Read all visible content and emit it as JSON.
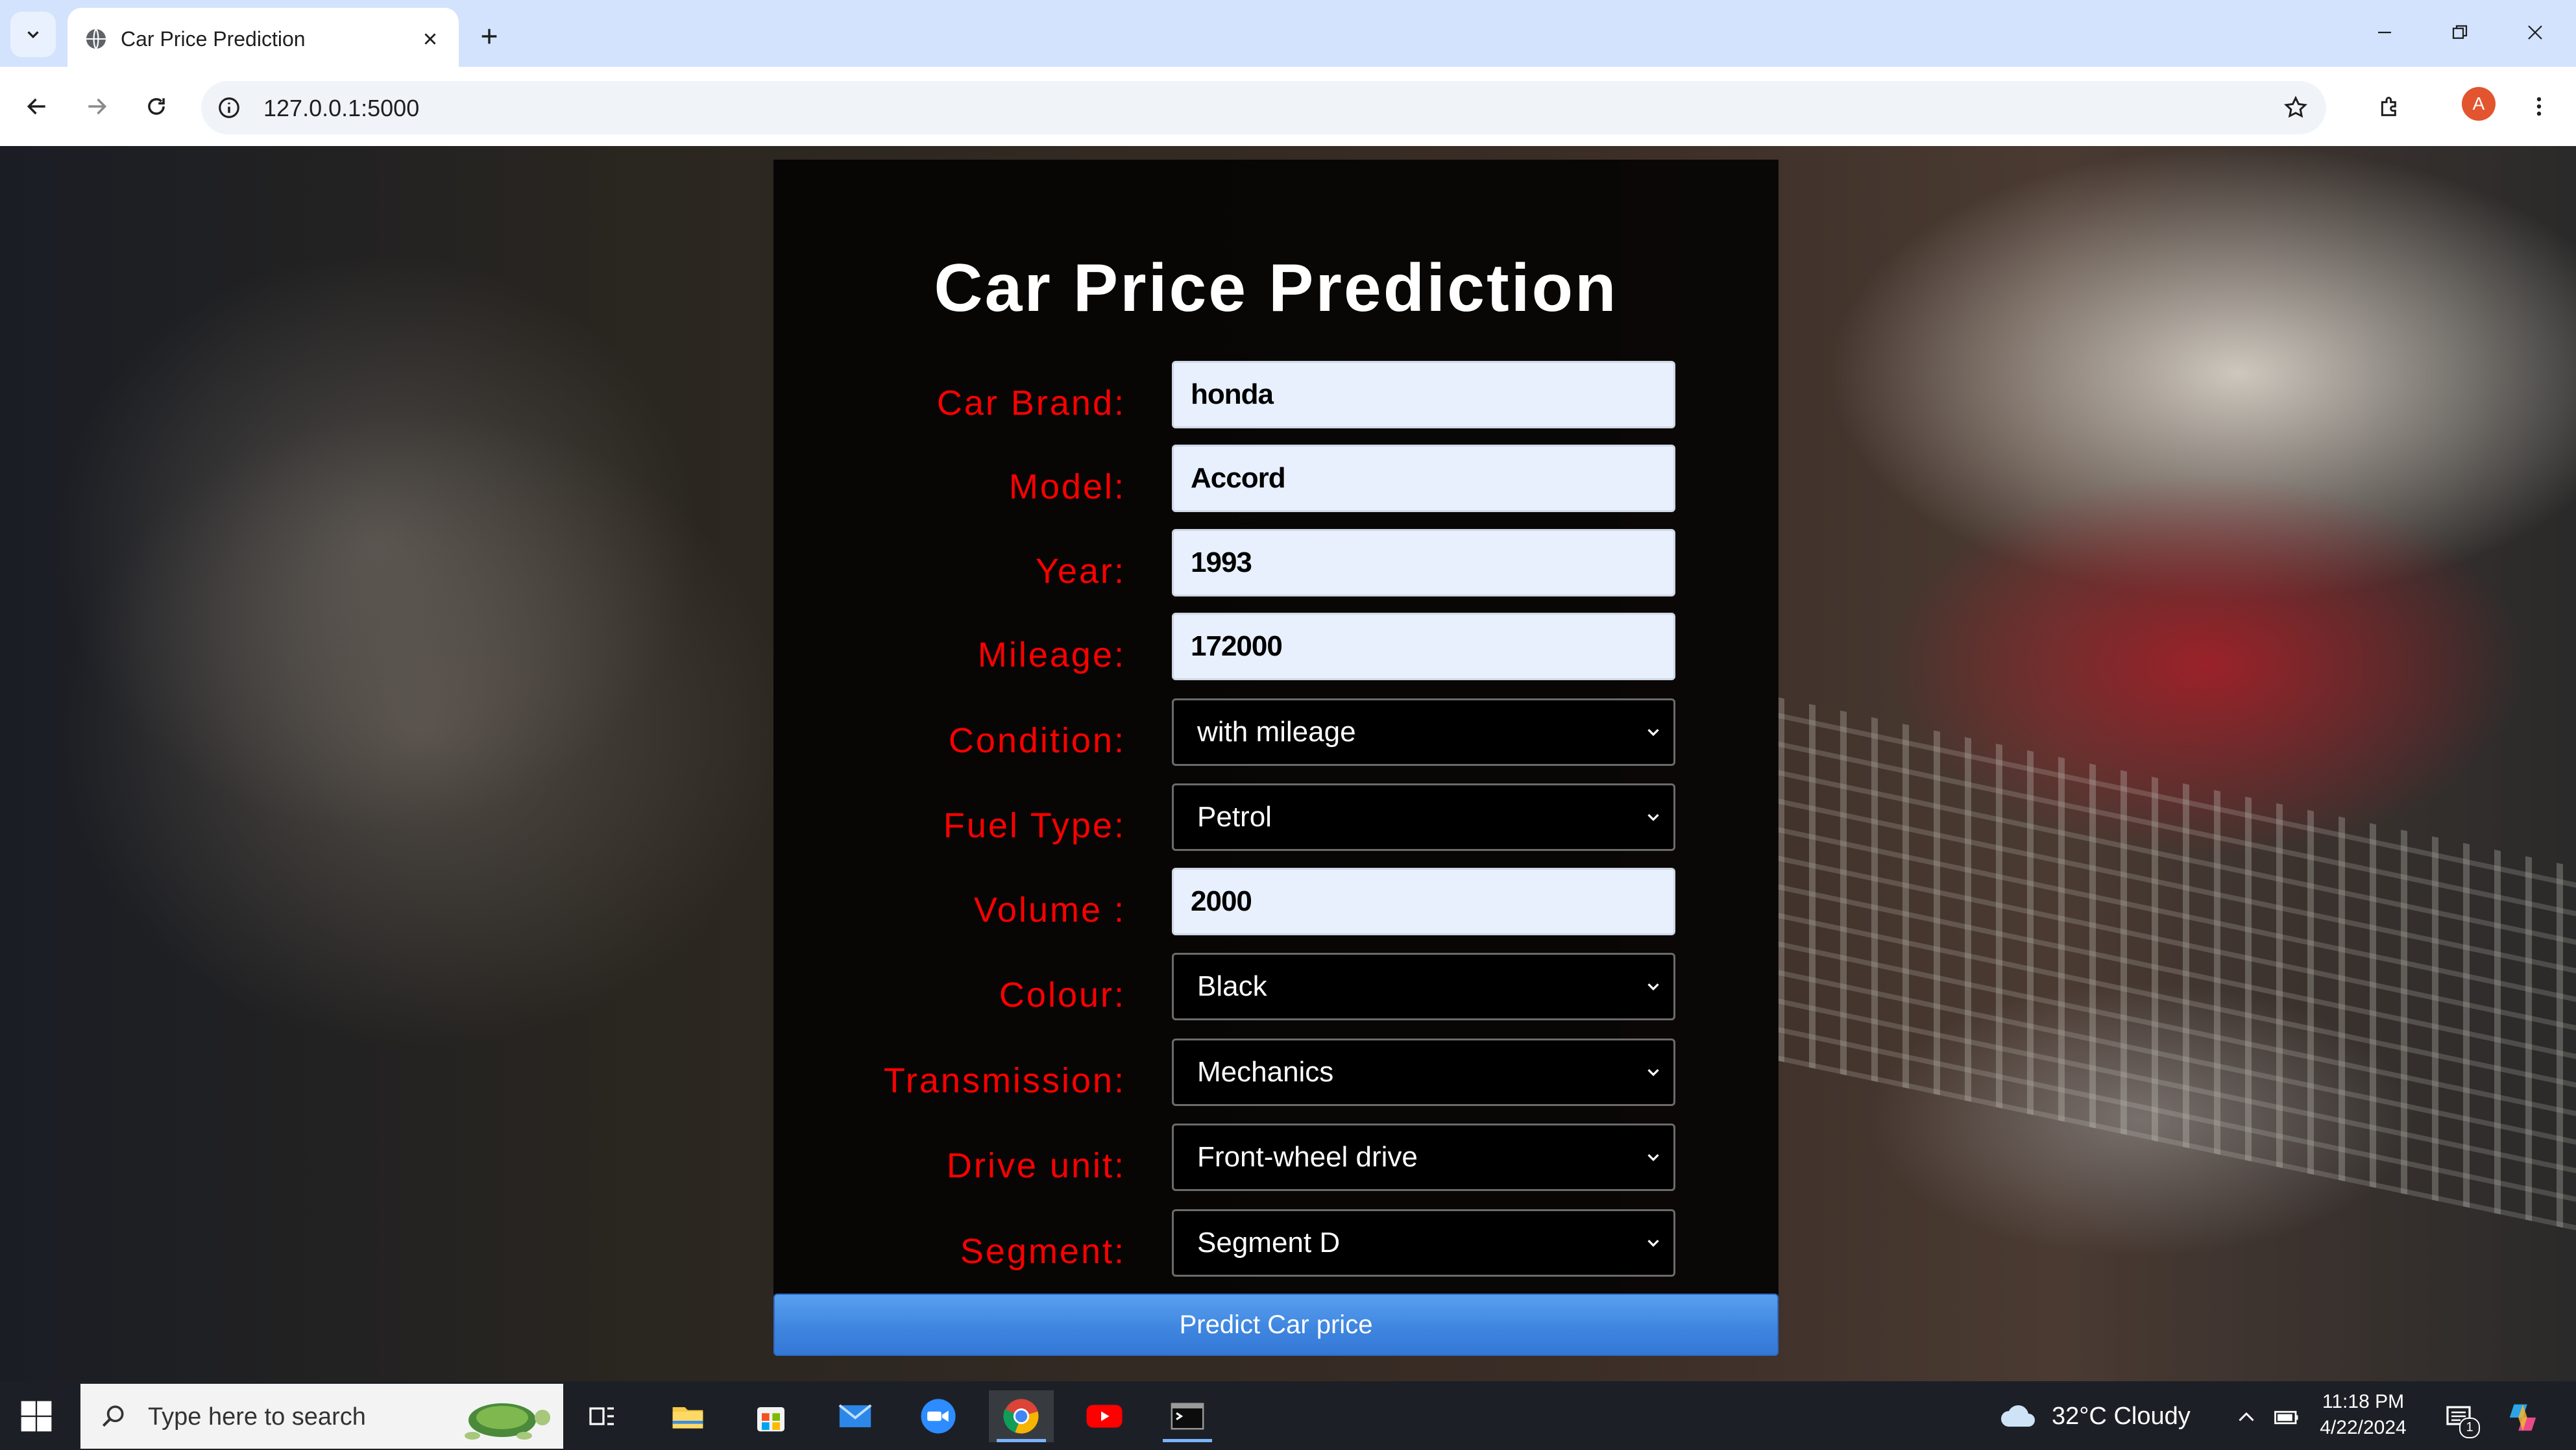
{
  "browser": {
    "tab_title": "Car Price Prediction",
    "url": "127.0.0.1:5000",
    "profile_initial": "A"
  },
  "form": {
    "title": "Car Price Prediction",
    "fields": [
      {
        "label": "Car Brand:",
        "type": "text",
        "value": "honda"
      },
      {
        "label": "Model:",
        "type": "text",
        "value": "Accord"
      },
      {
        "label": "Year:",
        "type": "text",
        "value": "1993"
      },
      {
        "label": "Mileage:",
        "type": "text",
        "value": "172000"
      },
      {
        "label": "Condition:",
        "type": "select",
        "value": "with mileage"
      },
      {
        "label": "Fuel Type:",
        "type": "select",
        "value": "Petrol"
      },
      {
        "label": "Volume :",
        "type": "text",
        "value": "2000"
      },
      {
        "label": "Colour:",
        "type": "select",
        "value": "Black"
      },
      {
        "label": "Transmission:",
        "type": "select",
        "value": "Mechanics"
      },
      {
        "label": "Drive unit:",
        "type": "select",
        "value": "Front-wheel drive"
      },
      {
        "label": "Segment:",
        "type": "select",
        "value": "Segment D"
      }
    ],
    "submit_label": "Predict Car price",
    "label_color": "#ff0000",
    "button_color": "#3f86e0"
  },
  "taskbar": {
    "search_placeholder": "Type here to search",
    "weather": "32°C  Cloudy",
    "time": "11:18 PM",
    "date": "4/22/2024",
    "notification_count": "1",
    "pinned_apps": [
      "task-view-icon",
      "file-explorer-icon",
      "microsoft-store-icon",
      "mail-icon",
      "zoom-icon",
      "chrome-icon",
      "youtube-icon",
      "terminal-icon"
    ]
  }
}
